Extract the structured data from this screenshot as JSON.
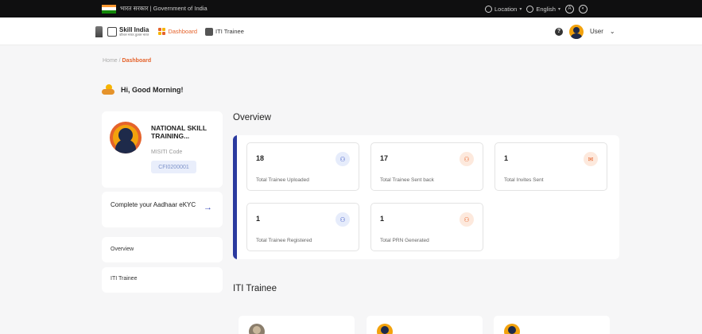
{
  "govbar": {
    "title": "भारत सरकार | Government of India",
    "location": "Location",
    "language": "English",
    "a_icon": "A"
  },
  "nav": {
    "logo_title": "Skill India",
    "logo_tagline": "कौशल भारत-कुशल भारत",
    "dashboard_label": "Dashboard",
    "iti_label": "ITI Trainee",
    "user_label": "User"
  },
  "breadcrumb": {
    "home": "Home",
    "separator": "/",
    "current": "Dashboard"
  },
  "greeting": "Hi, Good Morning!",
  "profile": {
    "org_name": "NATIONAL SKILL TRAINING...",
    "code_label": "MISITI Code",
    "code_value": "CFI0200001"
  },
  "kyc": {
    "label": "Complete your Aadhaar eKYC",
    "arrow": "→"
  },
  "sidebar": {
    "items": [
      {
        "label": "Overview"
      },
      {
        "label": "ITI Trainee"
      }
    ]
  },
  "overview": {
    "title": "Overview",
    "stats": [
      {
        "value": "18",
        "label": "Total Trainee Uploaded",
        "icon": "users-icon",
        "tone": "blue"
      },
      {
        "value": "17",
        "label": "Total Trainee Sent back",
        "icon": "user-return-icon",
        "tone": "orange"
      },
      {
        "value": "1",
        "label": "Total Invites Sent",
        "icon": "mail-icon",
        "tone": "orange"
      },
      {
        "value": "1",
        "label": "Total Trainee Registered",
        "icon": "user-check-icon",
        "tone": "blue"
      },
      {
        "value": "1",
        "label": "Total PRN Generated",
        "icon": "user-edit-icon",
        "tone": "orange"
      }
    ]
  },
  "iti_section": {
    "title": "ITI Trainee"
  },
  "colors": {
    "accent_orange": "#e5632b",
    "accent_blue": "#2b3a9f",
    "govbar_bg": "#0f0f10"
  }
}
